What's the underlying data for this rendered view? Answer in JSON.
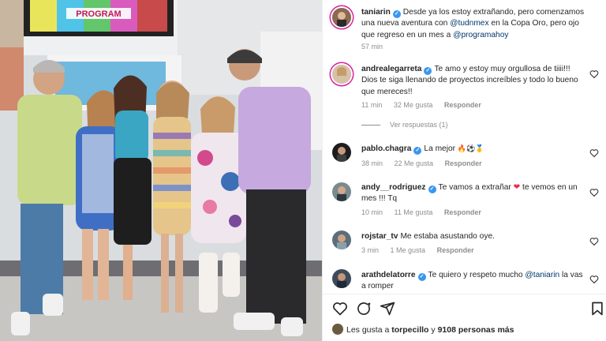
{
  "post": {
    "caption": {
      "username": "taniarin",
      "text_before": "Desde ya los estoy extrañando, pero comenzamos una nueva aventura con ",
      "mention1": "@tudnmex",
      "text_middle": " en la Copa Oro, pero ojo que regreso en un mes a ",
      "mention2": "@programahoy",
      "time": "57 min"
    },
    "photo": {
      "screen_text": "PROGRAM"
    }
  },
  "comments": [
    {
      "username": "andrealegarreta",
      "verified": true,
      "text": "Te amo y estoy muy orgullosa de tiiii!!! Dios te siga llenando de proyectos increíbles y todo lo bueno que mereces!!",
      "time": "11 min",
      "likes": "32 Me gusta",
      "reply": "Responder",
      "view_replies": "Ver respuestas (1)"
    },
    {
      "username": "pablo.chagra",
      "verified": true,
      "text": "La mejor ",
      "emojis": "🔥⚽🥇",
      "time": "38 min",
      "likes": "22 Me gusta",
      "reply": "Responder"
    },
    {
      "username": "andy__rodriguez",
      "verified": true,
      "text_before": "Te vamos a extrañar ",
      "heart": "❤",
      "text_after": " te vemos en un mes !!! Tq",
      "time": "10 min",
      "likes": "11 Me gusta",
      "reply": "Responder"
    },
    {
      "username": "rojstar_tv",
      "verified": false,
      "text": "Me estaba asustando oye.",
      "time": "3 min",
      "likes": "1 Me gusta",
      "reply": "Responder"
    },
    {
      "username": "arathdelatorre",
      "verified": true,
      "text_before": "Te quiero y respeto mucho ",
      "mention": "@taniarin",
      "text_after": " la vas a romper"
    }
  ],
  "footer": {
    "likes_prefix": "Les gusta a ",
    "likes_user": "torpecillo",
    "likes_middle": " y ",
    "likes_count": "9108 personas más"
  },
  "icons": {
    "like": "heart-icon",
    "comment": "comment-icon",
    "share": "send-icon",
    "save": "bookmark-icon"
  },
  "colors": {
    "mention": "#00376b",
    "verified": "#3897f0",
    "meta": "#8e8e8e"
  }
}
